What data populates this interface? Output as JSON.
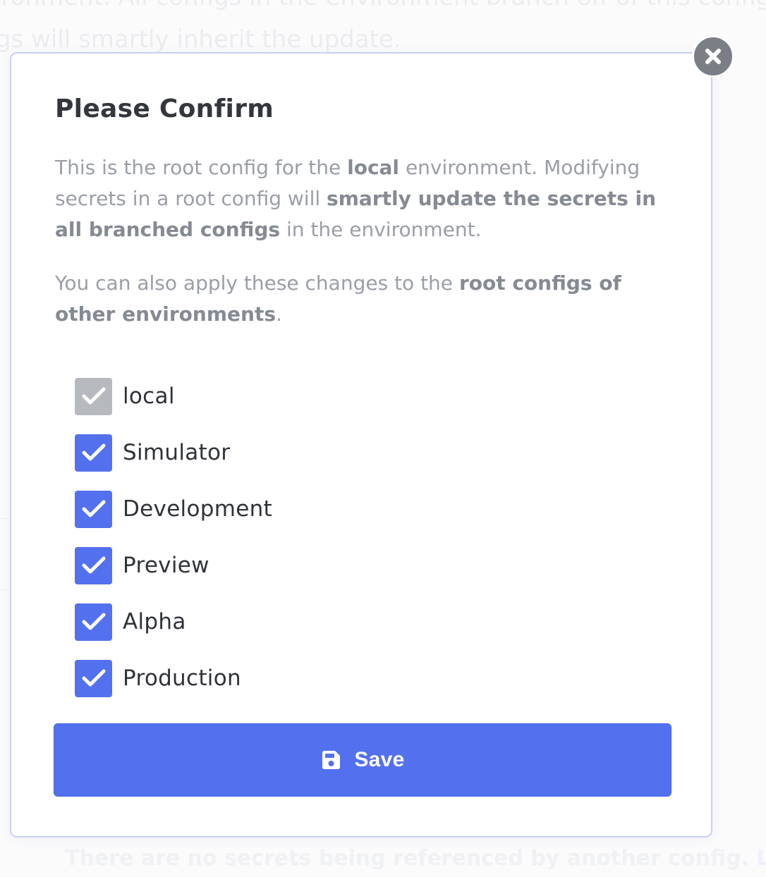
{
  "background": {
    "line1": "ironment. All configs in the environment branch off of this config",
    "line2": "gs will smartly inherit the update.",
    "footer_text": "There are no secrets being referenced by another config.",
    "footer_link": "Learn how"
  },
  "modal": {
    "title": "Please Confirm",
    "close_icon": "close-circle-icon",
    "paragraph1": {
      "t1": "This is the root config for the ",
      "b1": "local",
      "t2": " environment. Modifying secrets in a root config will ",
      "b2": "smartly update the secrets in all branched configs",
      "t3": " in the environment."
    },
    "paragraph2": {
      "t1": "You can also apply these changes to the ",
      "b1": "root configs of other environments",
      "t2": "."
    },
    "environments": [
      {
        "label": "local",
        "checked": true,
        "disabled": true
      },
      {
        "label": "Simulator",
        "checked": true,
        "disabled": false
      },
      {
        "label": "Development",
        "checked": true,
        "disabled": false
      },
      {
        "label": "Preview",
        "checked": true,
        "disabled": false
      },
      {
        "label": "Alpha",
        "checked": true,
        "disabled": false
      },
      {
        "label": "Production",
        "checked": true,
        "disabled": false
      }
    ],
    "save_button": {
      "label": "Save",
      "icon": "floppy-disk-icon"
    }
  },
  "colors": {
    "accent": "#5371ee",
    "disabled_checkbox": "#b6b9bd",
    "close_button": "#7b7f85",
    "modal_border": "#c9cff3"
  }
}
